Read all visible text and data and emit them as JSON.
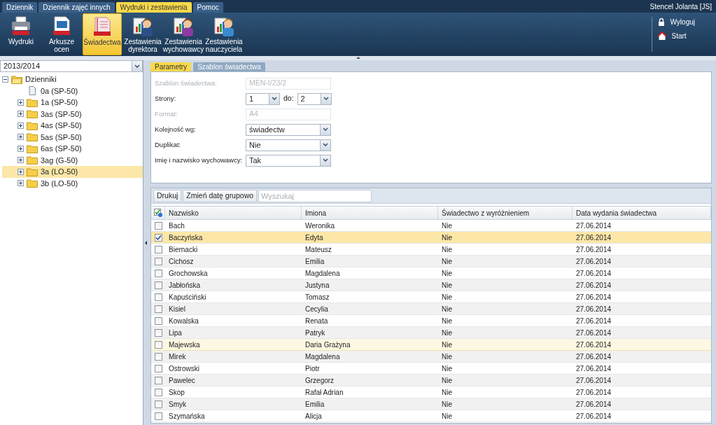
{
  "menu_tabs": [
    {
      "label": "Dziennik",
      "selected": false
    },
    {
      "label": "Dziennik zajęć innych",
      "selected": false
    },
    {
      "label": "Wydruki i zestawienia",
      "selected": true
    },
    {
      "label": "Pomoc",
      "selected": false
    }
  ],
  "user": "Stencel Jolanta [JS]",
  "toolbar": [
    {
      "label": "Wydruki",
      "kind": "printer",
      "selected": false
    },
    {
      "label": "Arkusze ocen",
      "kind": "grades",
      "selected": false
    },
    {
      "label": "Świadectwa",
      "kind": "certificate",
      "selected": true
    },
    {
      "label": "Zestawienia dyrektora",
      "kind": "man",
      "selected": false
    },
    {
      "label": "Zestawienia wychowawcy",
      "kind": "woman",
      "selected": false
    },
    {
      "label": "Zestawienia nauczyciela",
      "kind": "teacher",
      "selected": false
    }
  ],
  "side_links": [
    {
      "label": "Wyloguj",
      "kind": "lock"
    },
    {
      "label": "Start",
      "kind": "home"
    }
  ],
  "year_select": "2013/2014",
  "tree": {
    "label": "Dzienniki",
    "expanded": true,
    "children": [
      {
        "label": "0a (SP-50)",
        "kind": "file",
        "selected": false
      },
      {
        "label": "1a (SP-50)",
        "kind": "folder",
        "expanded": false,
        "selected": false
      },
      {
        "label": "3as (SP-50)",
        "kind": "folder",
        "expanded": false,
        "selected": false
      },
      {
        "label": "4as (SP-50)",
        "kind": "folder",
        "expanded": false,
        "selected": false
      },
      {
        "label": "5as (SP-50)",
        "kind": "folder",
        "expanded": false,
        "selected": false
      },
      {
        "label": "6as (SP-50)",
        "kind": "folder",
        "expanded": false,
        "selected": false
      },
      {
        "label": "3ag (G-50)",
        "kind": "folder",
        "expanded": false,
        "selected": false
      },
      {
        "label": "3a (LO-50)",
        "kind": "folder",
        "expanded": false,
        "selected": true
      },
      {
        "label": "3b (LO-50)",
        "kind": "folder",
        "expanded": false,
        "selected": false
      }
    ]
  },
  "panel_tabs": [
    {
      "label": "Parametry",
      "selected": true
    },
    {
      "label": "Szablon świadectwa",
      "selected": false
    }
  ],
  "form": [
    {
      "label": "Szablon świadectwa:",
      "kind": "text",
      "value": "MEN-I/23/2",
      "disabled": true
    },
    {
      "label": "Strony:",
      "kind": "range",
      "value": "1",
      "separator": "do:",
      "value_to": "2",
      "disabled": false
    },
    {
      "label": "Format:",
      "kind": "text",
      "value": "A4",
      "disabled": true
    },
    {
      "label": "Kolejność wg:",
      "kind": "select",
      "value": "świadectw",
      "disabled": false
    },
    {
      "label": "Duplikat:",
      "kind": "select",
      "value": "Nie",
      "disabled": false
    },
    {
      "label": "Imię i nazwisko wychowawcy:",
      "kind": "select",
      "value": "Tak",
      "disabled": false
    }
  ],
  "grid_toolbar": {
    "buttons": [
      "Drukuj",
      "Zmień datę grupowo"
    ],
    "search": {
      "placeholder": "Wyszukaj"
    }
  },
  "table": {
    "columns": [
      "Nazwisko",
      "Imiona",
      "Świadectwo z wyróżnieniem",
      "Data wydania świadectwa"
    ],
    "rows": [
      {
        "cells": [
          "Bach",
          "Weronika",
          "Nie",
          "27.06.2014"
        ],
        "checked": false,
        "selected": false,
        "hovered": false
      },
      {
        "cells": [
          "Baczyńska",
          "Edyta",
          "Nie",
          "27.06.2014"
        ],
        "checked": true,
        "selected": true,
        "hovered": false
      },
      {
        "cells": [
          "Biernacki",
          "Mateusz",
          "Nie",
          "27.06.2014"
        ],
        "checked": false,
        "selected": false,
        "hovered": false
      },
      {
        "cells": [
          "Cichosz",
          "Emilia",
          "Nie",
          "27.06.2014"
        ],
        "checked": false,
        "selected": false,
        "hovered": false
      },
      {
        "cells": [
          "Grochowska",
          "Magdalena",
          "Nie",
          "27.06.2014"
        ],
        "checked": false,
        "selected": false,
        "hovered": false
      },
      {
        "cells": [
          "Jabłońska",
          "Justyna",
          "Nie",
          "27.06.2014"
        ],
        "checked": false,
        "selected": false,
        "hovered": false
      },
      {
        "cells": [
          "Kapuściński",
          "Tomasz",
          "Nie",
          "27.06.2014"
        ],
        "checked": false,
        "selected": false,
        "hovered": false
      },
      {
        "cells": [
          "Kisiel",
          "Cecylia",
          "Nie",
          "27.06.2014"
        ],
        "checked": false,
        "selected": false,
        "hovered": false
      },
      {
        "cells": [
          "Kowalska",
          "Renata",
          "Nie",
          "27.06.2014"
        ],
        "checked": false,
        "selected": false,
        "hovered": false
      },
      {
        "cells": [
          "Lipa",
          "Patryk",
          "Nie",
          "27.06.2014"
        ],
        "checked": false,
        "selected": false,
        "hovered": false
      },
      {
        "cells": [
          "Majewska",
          "Daria Grażyna",
          "Nie",
          "27.06.2014"
        ],
        "checked": false,
        "selected": false,
        "hovered": true
      },
      {
        "cells": [
          "Mirek",
          "Magdalena",
          "Nie",
          "27.06.2014"
        ],
        "checked": false,
        "selected": false,
        "hovered": false
      },
      {
        "cells": [
          "Ostrowski",
          "Piotr",
          "Nie",
          "27.06.2014"
        ],
        "checked": false,
        "selected": false,
        "hovered": false
      },
      {
        "cells": [
          "Pawelec",
          "Grzegorz",
          "Nie",
          "27.06.2014"
        ],
        "checked": false,
        "selected": false,
        "hovered": false
      },
      {
        "cells": [
          "Skop",
          "Rafał Adrian",
          "Nie",
          "27.06.2014"
        ],
        "checked": false,
        "selected": false,
        "hovered": false
      },
      {
        "cells": [
          "Smyk",
          "Emilia",
          "Nie",
          "27.06.2014"
        ],
        "checked": false,
        "selected": false,
        "hovered": false
      },
      {
        "cells": [
          "Szymańska",
          "Alicja",
          "Nie",
          "27.06.2014"
        ],
        "checked": false,
        "selected": false,
        "hovered": false
      }
    ]
  }
}
